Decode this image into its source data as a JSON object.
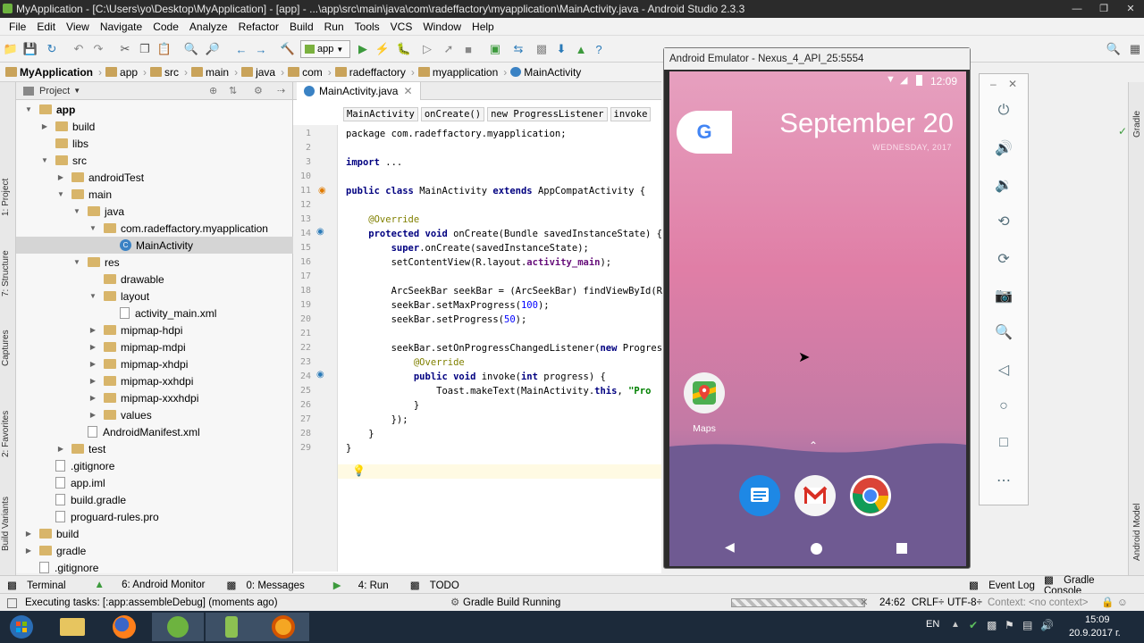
{
  "window": {
    "title": "MyApplication - [C:\\Users\\yo\\Desktop\\MyApplication] - [app] - ...\\app\\src\\main\\java\\com\\radeffactory\\myapplication\\MainActivity.java - Android Studio 2.3.3"
  },
  "menu": [
    "File",
    "Edit",
    "View",
    "Navigate",
    "Code",
    "Analyze",
    "Refactor",
    "Build",
    "Run",
    "Tools",
    "VCS",
    "Window",
    "Help"
  ],
  "toolbar": {
    "run_config": "app"
  },
  "breadcrumb": [
    "MyApplication",
    "app",
    "src",
    "main",
    "java",
    "com",
    "radeffactory",
    "myapplication",
    "MainActivity"
  ],
  "project": {
    "header": "Project",
    "tree": [
      {
        "label": "app",
        "type": "folder",
        "arrow": "open",
        "bold": true
      },
      {
        "label": "build",
        "type": "folder",
        "arrow": "closed"
      },
      {
        "label": "libs",
        "type": "folder",
        "arrow": ""
      },
      {
        "label": "src",
        "type": "folder",
        "arrow": "open"
      },
      {
        "label": "androidTest",
        "type": "folder",
        "arrow": "closed"
      },
      {
        "label": "main",
        "type": "folder",
        "arrow": "open"
      },
      {
        "label": "java",
        "type": "folder",
        "arrow": "open"
      },
      {
        "label": "com.radeffactory.myapplication",
        "type": "folder",
        "arrow": "open"
      },
      {
        "label": "MainActivity",
        "type": "class",
        "arrow": "",
        "selected": true
      },
      {
        "label": "res",
        "type": "folder",
        "arrow": "open"
      },
      {
        "label": "drawable",
        "type": "folder",
        "arrow": ""
      },
      {
        "label": "layout",
        "type": "folder",
        "arrow": "open"
      },
      {
        "label": "activity_main.xml",
        "type": "file",
        "arrow": ""
      },
      {
        "label": "mipmap-hdpi",
        "type": "folder",
        "arrow": "closed"
      },
      {
        "label": "mipmap-mdpi",
        "type": "folder",
        "arrow": "closed"
      },
      {
        "label": "mipmap-xhdpi",
        "type": "folder",
        "arrow": "closed"
      },
      {
        "label": "mipmap-xxhdpi",
        "type": "folder",
        "arrow": "closed"
      },
      {
        "label": "mipmap-xxxhdpi",
        "type": "folder",
        "arrow": "closed"
      },
      {
        "label": "values",
        "type": "folder",
        "arrow": "closed"
      },
      {
        "label": "AndroidManifest.xml",
        "type": "file",
        "arrow": ""
      },
      {
        "label": "test",
        "type": "folder",
        "arrow": "closed"
      },
      {
        "label": ".gitignore",
        "type": "file",
        "arrow": ""
      },
      {
        "label": "app.iml",
        "type": "file",
        "arrow": ""
      },
      {
        "label": "build.gradle",
        "type": "file",
        "arrow": ""
      },
      {
        "label": "proguard-rules.pro",
        "type": "file",
        "arrow": ""
      },
      {
        "label": "build",
        "type": "folder",
        "arrow": "closed"
      },
      {
        "label": "gradle",
        "type": "folder",
        "arrow": "closed"
      },
      {
        "label": ".gitignore",
        "type": "file",
        "arrow": ""
      }
    ]
  },
  "left_strip": [
    "1: Project",
    "7: Structure",
    "Captures",
    "2: Favorites",
    "Build Variants"
  ],
  "right_strip": [
    "Gradle",
    "Android Model"
  ],
  "editor": {
    "tab": "MainActivity.java",
    "crumbs": [
      "MainActivity",
      "onCreate()",
      "new ProgressListener",
      "invoke"
    ],
    "line_numbers": [
      "1",
      "2",
      "3",
      "10",
      "11",
      "12",
      "13",
      "14",
      "15",
      "16",
      "17",
      "18",
      "19",
      "20",
      "21",
      "22",
      "23",
      "24",
      "25",
      "26",
      "27",
      "28",
      "29"
    ]
  },
  "emulator": {
    "title": "Android Emulator - Nexus_4_API_25:5554",
    "time": "12:09",
    "date": "September 20",
    "weekday": "WEDNESDAY, 2017",
    "maps_label": "Maps",
    "google_letter": "G"
  },
  "tool_windows": [
    "Terminal",
    "6: Android Monitor",
    "0: Messages",
    "4: Run",
    "TODO",
    "Event Log",
    "Gradle Console"
  ],
  "status": {
    "message": "Executing tasks: [:app:assembleDebug] (moments ago)",
    "build": "Gradle Build Running",
    "position": "24:62",
    "line_sep": "CRLF÷",
    "encoding": "UTF-8÷",
    "context": "Context: <no context>"
  },
  "taskbar": {
    "lang": "EN",
    "time": "15:09",
    "date": "20.9.2017 г."
  },
  "colors": {
    "keyword": "#000080",
    "annotation": "#808000",
    "string": "#008000",
    "number": "#0000ff",
    "field": "#660e7a"
  }
}
